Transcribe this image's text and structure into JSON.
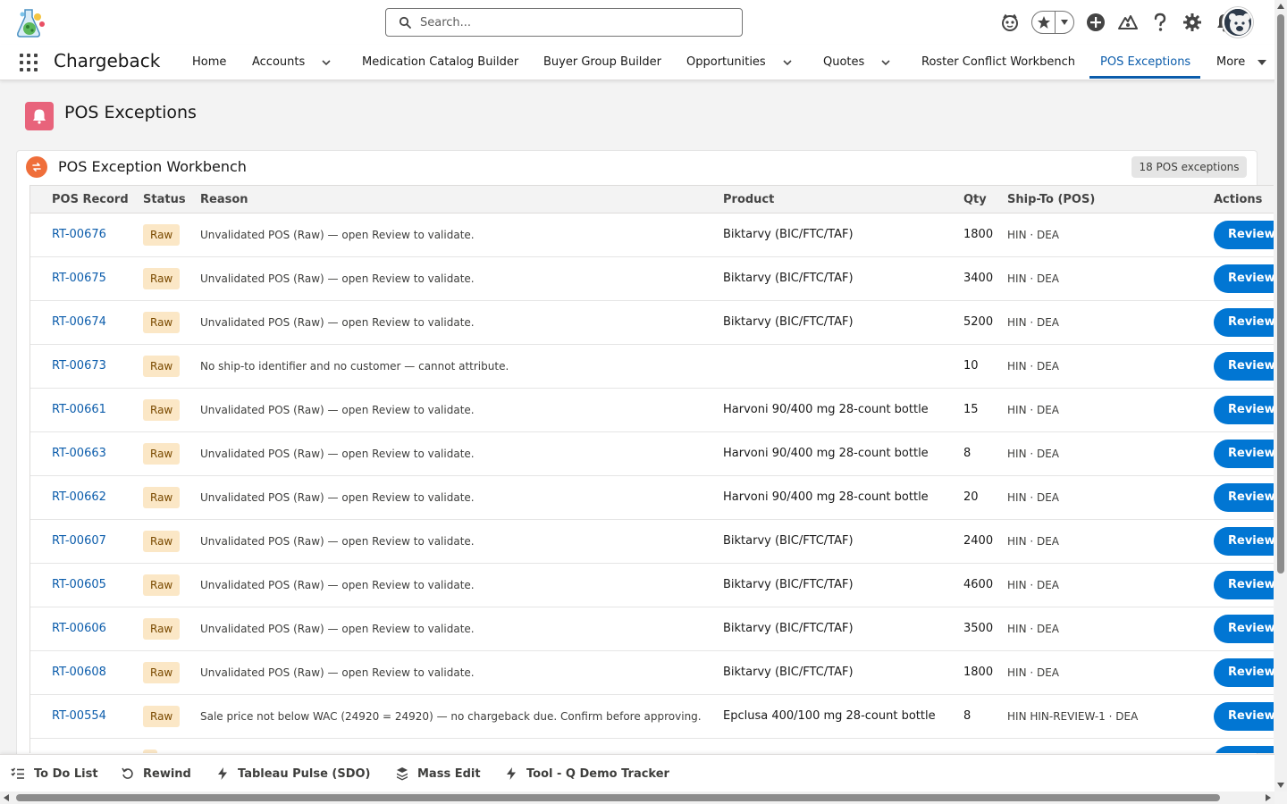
{
  "header": {
    "search_placeholder": "Search...",
    "icons": [
      "einstein-icon",
      "favorites-star-icon",
      "favorites-caret-icon",
      "add-icon",
      "trailhead-icon",
      "help-icon",
      "setup-gear-icon",
      "notifications-bell-icon",
      "avatar"
    ]
  },
  "nav": {
    "app_name": "Chargeback",
    "items": [
      {
        "label": "Home",
        "has_menu": false
      },
      {
        "label": "Accounts",
        "has_menu": true
      },
      {
        "label": "Medication Catalog Builder",
        "has_menu": false
      },
      {
        "label": "Buyer Group Builder",
        "has_menu": false
      },
      {
        "label": "Opportunities",
        "has_menu": true
      },
      {
        "label": "Quotes",
        "has_menu": true
      },
      {
        "label": "Roster Conflict Workbench",
        "has_menu": false
      },
      {
        "label": "POS Exceptions",
        "has_menu": false,
        "active": true
      },
      {
        "label": "More",
        "has_menu": true
      }
    ]
  },
  "page": {
    "title": "POS Exceptions",
    "icon_color": "#e8637b"
  },
  "card": {
    "title": "POS Exception Workbench",
    "count_label": "18 POS exceptions",
    "icon_color": "#ef6e3a"
  },
  "table": {
    "columns": [
      "POS Record",
      "Status",
      "Reason",
      "Product",
      "Qty",
      "Ship-To (POS)",
      "Actions"
    ],
    "action_label": "Review",
    "rows": [
      {
        "record": "RT-00676",
        "status": "Raw",
        "reason": "Unvalidated POS (Raw) — open Review to validate.",
        "product": "Biktarvy (BIC/FTC/TAF)",
        "qty": "1800",
        "ship_to": "HIN · DEA"
      },
      {
        "record": "RT-00675",
        "status": "Raw",
        "reason": "Unvalidated POS (Raw) — open Review to validate.",
        "product": "Biktarvy (BIC/FTC/TAF)",
        "qty": "3400",
        "ship_to": "HIN · DEA"
      },
      {
        "record": "RT-00674",
        "status": "Raw",
        "reason": "Unvalidated POS (Raw) — open Review to validate.",
        "product": "Biktarvy (BIC/FTC/TAF)",
        "qty": "5200",
        "ship_to": "HIN · DEA"
      },
      {
        "record": "RT-00673",
        "status": "Raw",
        "reason": "No ship-to identifier and no customer — cannot attribute.",
        "product": "",
        "qty": "10",
        "ship_to": "HIN · DEA"
      },
      {
        "record": "RT-00661",
        "status": "Raw",
        "reason": "Unvalidated POS (Raw) — open Review to validate.",
        "product": "Harvoni 90/400 mg 28-count bottle",
        "qty": "15",
        "ship_to": "HIN · DEA"
      },
      {
        "record": "RT-00663",
        "status": "Raw",
        "reason": "Unvalidated POS (Raw) — open Review to validate.",
        "product": "Harvoni 90/400 mg 28-count bottle",
        "qty": "8",
        "ship_to": "HIN · DEA"
      },
      {
        "record": "RT-00662",
        "status": "Raw",
        "reason": "Unvalidated POS (Raw) — open Review to validate.",
        "product": "Harvoni 90/400 mg 28-count bottle",
        "qty": "20",
        "ship_to": "HIN · DEA"
      },
      {
        "record": "RT-00607",
        "status": "Raw",
        "reason": "Unvalidated POS (Raw) — open Review to validate.",
        "product": "Biktarvy (BIC/FTC/TAF)",
        "qty": "2400",
        "ship_to": "HIN · DEA"
      },
      {
        "record": "RT-00605",
        "status": "Raw",
        "reason": "Unvalidated POS (Raw) — open Review to validate.",
        "product": "Biktarvy (BIC/FTC/TAF)",
        "qty": "4600",
        "ship_to": "HIN · DEA"
      },
      {
        "record": "RT-00606",
        "status": "Raw",
        "reason": "Unvalidated POS (Raw) — open Review to validate.",
        "product": "Biktarvy (BIC/FTC/TAF)",
        "qty": "3500",
        "ship_to": "HIN · DEA"
      },
      {
        "record": "RT-00608",
        "status": "Raw",
        "reason": "Unvalidated POS (Raw) — open Review to validate.",
        "product": "Biktarvy (BIC/FTC/TAF)",
        "qty": "1800",
        "ship_to": "HIN · DEA"
      },
      {
        "record": "RT-00554",
        "status": "Raw",
        "reason": "Sale price not below WAC (24920 = 24920) — no chargeback due. Confirm before approving.",
        "product": "Epclusa 400/100 mg 28-count bottle",
        "qty": "8",
        "ship_to": "HIN HIN-REVIEW-1 · DEA"
      }
    ]
  },
  "utility_bar": {
    "items": [
      {
        "label": "To Do List",
        "icon": "checklist-icon"
      },
      {
        "label": "Rewind",
        "icon": "rewind-icon"
      },
      {
        "label": "Tableau Pulse (SDO)",
        "icon": "lightning-icon"
      },
      {
        "label": "Mass Edit",
        "icon": "layers-icon"
      },
      {
        "label": "Tool - Q Demo Tracker",
        "icon": "lightning-icon"
      }
    ]
  },
  "colors": {
    "brand_blue": "#0176d3",
    "link_blue": "#0b5cab",
    "raw_badge_bg": "#fbe7c6",
    "raw_badge_text": "#7a4a00"
  }
}
